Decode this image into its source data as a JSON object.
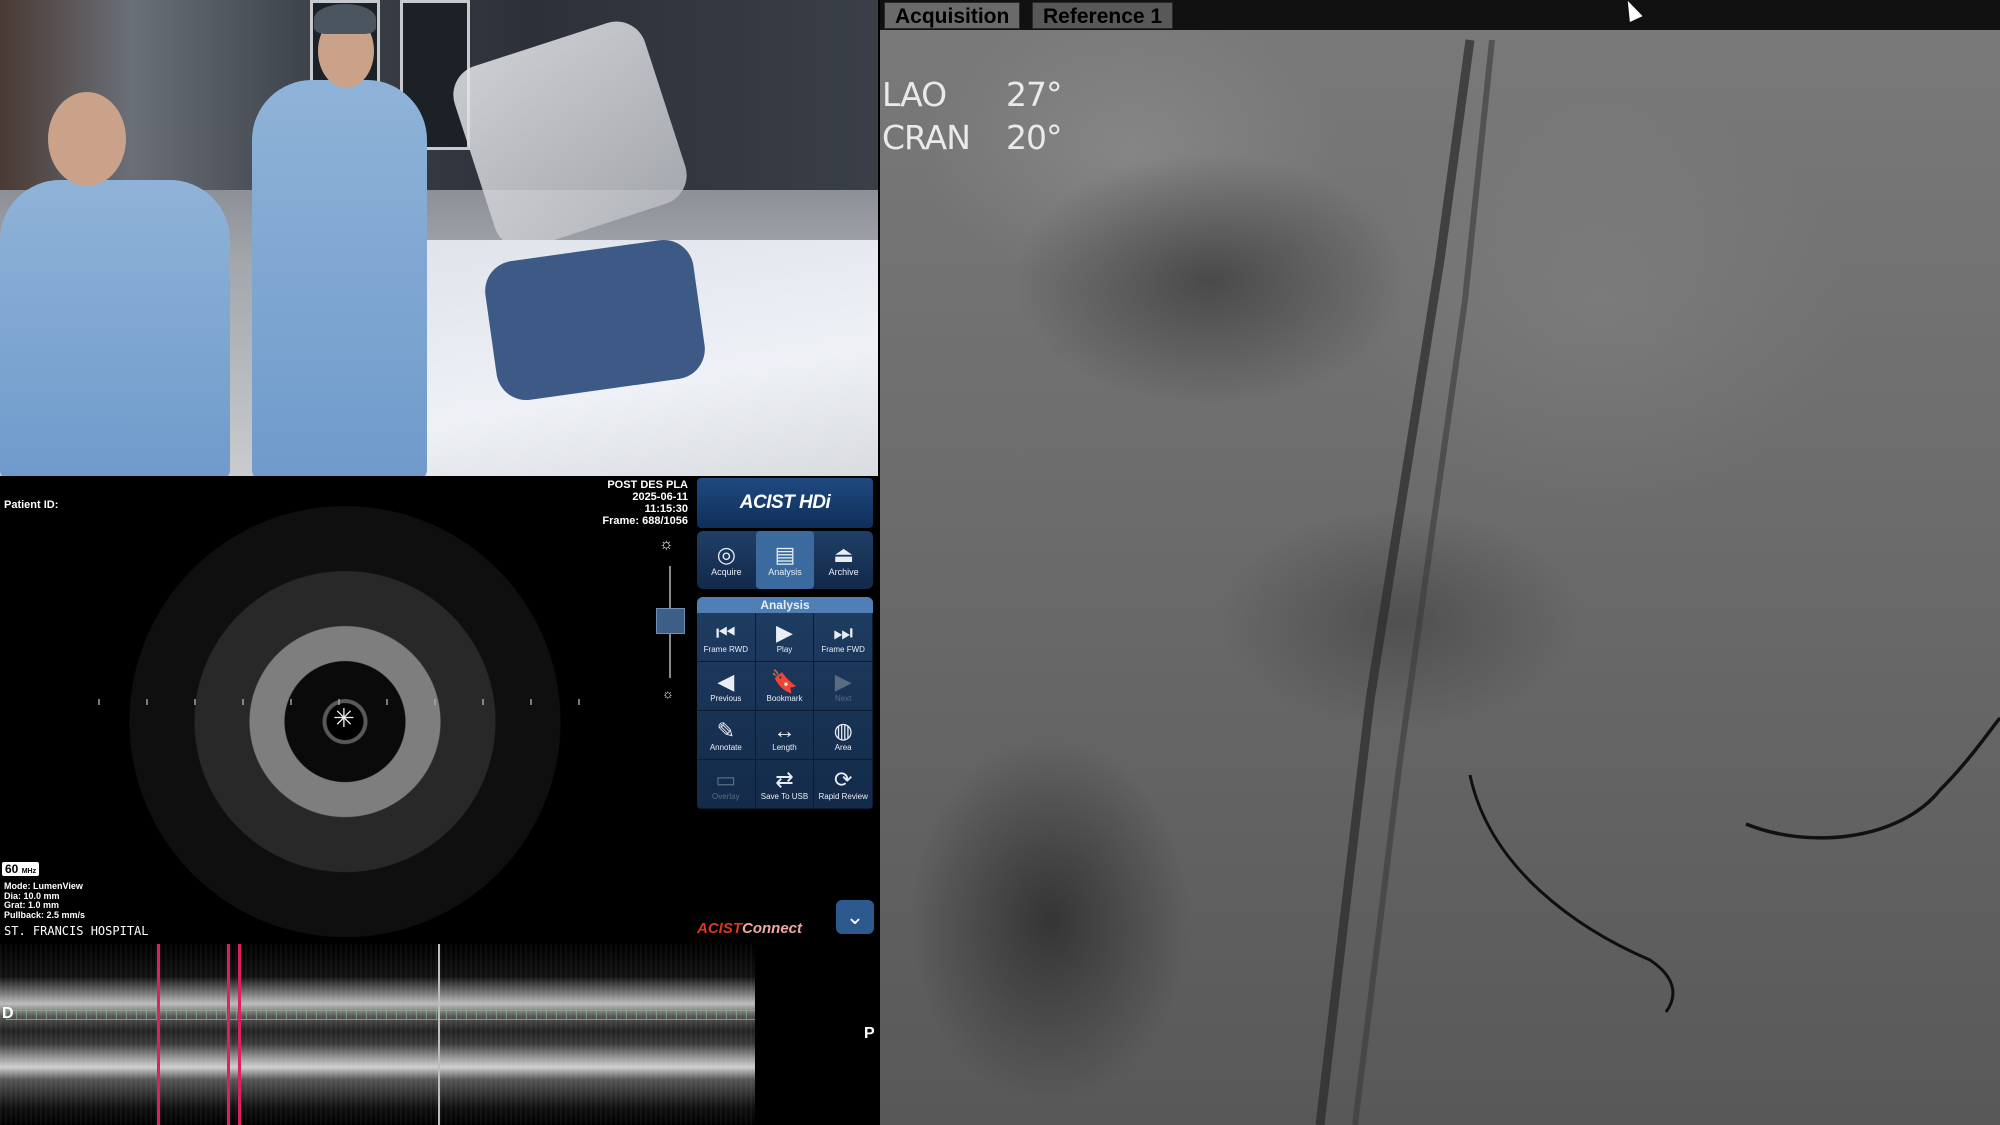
{
  "ivus": {
    "patient_label": "Patient ID:",
    "study": "POST DES PLA",
    "date": "2025-06-11",
    "time": "11:15:30",
    "frame": "Frame: 688/1056",
    "mhz_value": "60",
    "mhz_unit": "MHz",
    "info": {
      "mode": "Mode: LumenView",
      "dia": "Dia: 10.0 mm",
      "grat": "Grat: 1.0 mm",
      "pullback": "Pullback: 2.5 mm/s"
    },
    "hospital": "ST. FRANCIS HOSPITAL",
    "distal_label": "D",
    "proximal_label": "P"
  },
  "panel": {
    "logo": "ACIST HDi",
    "modes": [
      {
        "label": "Acquire",
        "icon": "acquire-icon"
      },
      {
        "label": "Analysis",
        "icon": "ruler-icon"
      },
      {
        "label": "Archive",
        "icon": "archive-icon"
      }
    ],
    "analysis_header": "Analysis",
    "tools": [
      {
        "label": "Frame RWD",
        "icon": "frame-rewind-icon",
        "enabled": true
      },
      {
        "label": "Play",
        "icon": "play-icon",
        "enabled": true
      },
      {
        "label": "Frame FWD",
        "icon": "frame-forward-icon",
        "enabled": true
      },
      {
        "label": "Previous",
        "icon": "previous-icon",
        "enabled": true
      },
      {
        "label": "Bookmark",
        "icon": "bookmark-icon",
        "enabled": true
      },
      {
        "label": "Next",
        "icon": "next-icon",
        "enabled": false
      },
      {
        "label": "Annotate",
        "icon": "annotate-icon",
        "enabled": true
      },
      {
        "label": "Length",
        "icon": "length-icon",
        "enabled": true
      },
      {
        "label": "Area",
        "icon": "area-icon",
        "enabled": true
      },
      {
        "label": "Overlay",
        "icon": "overlay-icon",
        "enabled": false
      },
      {
        "label": "Save To USB",
        "icon": "usb-icon",
        "enabled": true
      },
      {
        "label": "Rapid Review",
        "icon": "rapid-review-icon",
        "enabled": true
      }
    ],
    "connect_a": "ACIST",
    "connect_b": "Connect"
  },
  "angio": {
    "tabs": [
      "Acquisition",
      "Reference 1"
    ],
    "active_tab": "Reference 1",
    "lao_label": "LAO",
    "lao_value": "27°",
    "cran_label": "CRAN",
    "cran_value": "20°"
  },
  "colors": {
    "accent_blue": "#2c5a8f",
    "marker_magenta": "#e01e63",
    "connect_red": "#d9381e"
  }
}
